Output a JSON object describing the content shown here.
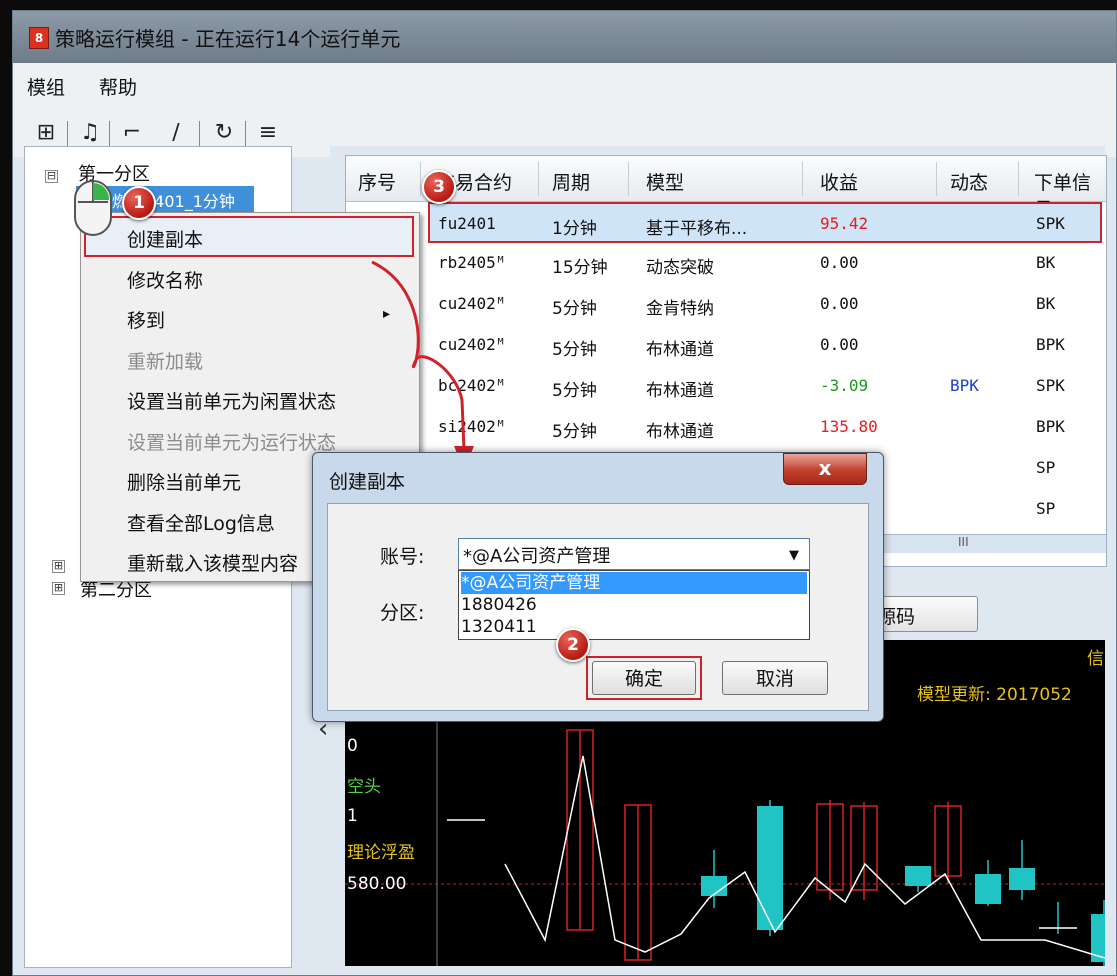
{
  "window": {
    "title": "策略运行模组 - 正在运行14个运行单元",
    "icon_glyph": "8"
  },
  "menubar": {
    "items": [
      "模组",
      "帮助"
    ]
  },
  "toolbar": {
    "icons": [
      "add-icon",
      "bell-icon",
      "signal-rise-icon",
      "signal-fall-icon",
      "refresh-icon",
      "export-icon"
    ],
    "glyphs": [
      "⊞",
      "♫",
      "⌐",
      "∕",
      "↻",
      "≡"
    ]
  },
  "tree": {
    "nodes": [
      {
        "label": "第一分区",
        "expander": "⊟"
      },
      {
        "label": "燃油2401_1分钟"
      },
      {
        "label": "第二分区",
        "expander": "⊞"
      }
    ],
    "extra_expander": "⊞"
  },
  "grid": {
    "headers": [
      "序号",
      "交易合约",
      "周期",
      "模型",
      "收益",
      "动态",
      "下单信号"
    ],
    "rows": [
      {
        "contract": "fu2401",
        "period": "1分钟",
        "model": "基于平移布...",
        "profit": "95.42",
        "profit_color": "#e02020",
        "dynamic": "",
        "signal": "SPK"
      },
      {
        "contract": "rb2405ᴹ",
        "period": "15分钟",
        "model": "动态突破",
        "profit": "0.00",
        "profit_color": "#111111",
        "dynamic": "",
        "signal": "BK"
      },
      {
        "contract": "cu2402ᴹ",
        "period": "5分钟",
        "model": "金肯特纳",
        "profit": "0.00",
        "profit_color": "#111111",
        "dynamic": "",
        "signal": "BK"
      },
      {
        "contract": "cu2402ᴹ",
        "period": "5分钟",
        "model": "布林通道",
        "profit": "0.00",
        "profit_color": "#111111",
        "dynamic": "",
        "signal": "BPK"
      },
      {
        "contract": "bc2402ᴹ",
        "period": "5分钟",
        "model": "布林通道",
        "profit": "-3.09",
        "profit_color": "#1a9a1a",
        "dynamic": "BPK",
        "signal": "SPK"
      },
      {
        "contract": "si2402ᴹ",
        "period": "5分钟",
        "model": "布林通道",
        "profit": "135.80",
        "profit_color": "#e02020",
        "dynamic": "",
        "signal": "BPK"
      },
      {
        "contract": "",
        "period": "",
        "model": "",
        "profit": "",
        "profit_color": "#111111",
        "dynamic": "",
        "signal": "SP"
      },
      {
        "contract": "",
        "period": "",
        "model": "",
        "profit": "",
        "profit_color": "#111111",
        "dynamic": "",
        "signal": "SP"
      }
    ],
    "scroll_glyph": "III"
  },
  "source_button": {
    "label": "源码"
  },
  "context_menu": {
    "items": [
      {
        "label": "创建副本",
        "disabled": false
      },
      {
        "label": "修改名称",
        "disabled": false
      },
      {
        "label": "移到",
        "disabled": false,
        "submenu": "▸"
      },
      {
        "label": "重新加载",
        "disabled": true
      },
      {
        "label": "设置当前单元为闲置状态",
        "disabled": false
      },
      {
        "label": "设置当前单元为运行状态",
        "disabled": true
      },
      {
        "label": "删除当前单元",
        "disabled": false
      },
      {
        "label": "查看全部Log信息",
        "disabled": false
      },
      {
        "label": "重新载入该模型内容",
        "disabled": false
      }
    ]
  },
  "dialog": {
    "title": "创建副本",
    "close_glyph": "x",
    "account_label": "账号:",
    "partition_label": "分区:",
    "account_value": "*@A公司资产管理",
    "combo_arrow": "▼",
    "options": [
      "*@A公司资产管理",
      "1880426",
      "1320411"
    ],
    "ok_label": "确定",
    "cancel_label": "取消"
  },
  "markers": [
    "1",
    "2",
    "3"
  ],
  "chart_panel": {
    "labels": [
      "0",
      "空头",
      "1",
      "理论浮盈",
      "580.00"
    ],
    "top_right_fragment": "信",
    "update_text": "模型更新: 2017052",
    "left_arrow": "‹",
    "colors": {
      "bull": "#20c4c4",
      "bear": "#d62222",
      "line": "#ffffff",
      "text_yellow": "#e6c21a",
      "text_white": "#ffffff"
    }
  }
}
